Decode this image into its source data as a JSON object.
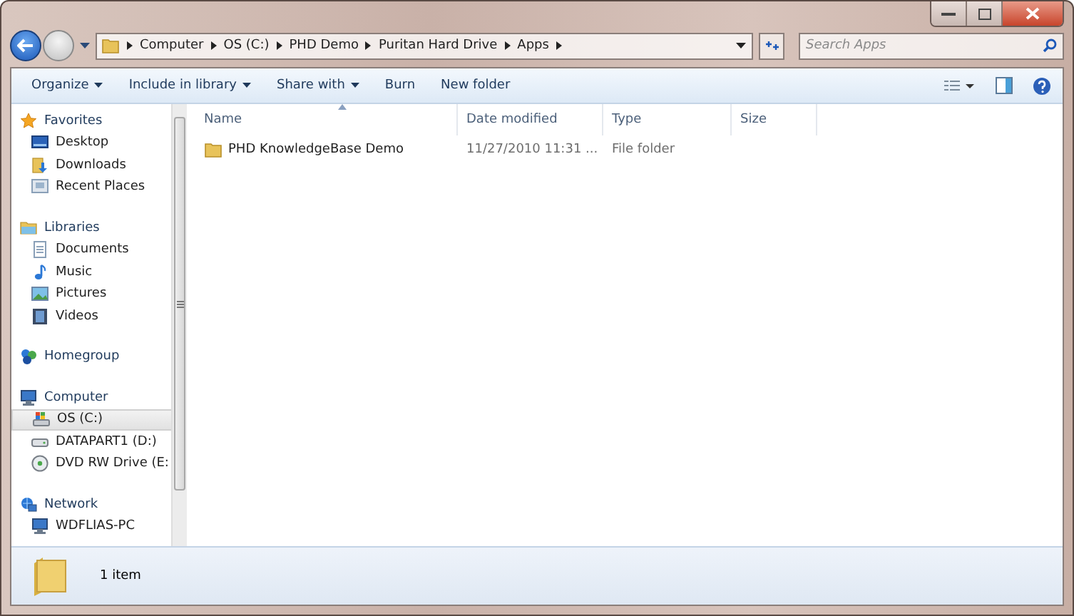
{
  "address_bar": {
    "breadcrumbs": [
      "Computer",
      "OS (C:)",
      "PHD Demo",
      "Puritan Hard Drive",
      "Apps"
    ]
  },
  "search": {
    "placeholder": "Search Apps"
  },
  "toolbar": {
    "buttons": [
      {
        "label": "Organize",
        "dropdown": true
      },
      {
        "label": "Include in library",
        "dropdown": true
      },
      {
        "label": "Share with",
        "dropdown": true
      },
      {
        "label": "Burn",
        "dropdown": false
      },
      {
        "label": "New folder",
        "dropdown": false
      }
    ]
  },
  "navigation": [
    {
      "label": "Favorites",
      "kind": "star",
      "children": [
        {
          "label": "Desktop",
          "kind": "desktop",
          "selected": false
        },
        {
          "label": "Downloads",
          "kind": "downloads",
          "selected": false
        },
        {
          "label": "Recent Places",
          "kind": "recent",
          "selected": false
        }
      ]
    },
    {
      "label": "Libraries",
      "kind": "library",
      "children": [
        {
          "label": "Documents",
          "kind": "documents",
          "selected": false
        },
        {
          "label": "Music",
          "kind": "music",
          "selected": false
        },
        {
          "label": "Pictures",
          "kind": "pictures",
          "selected": false
        },
        {
          "label": "Videos",
          "kind": "videos",
          "selected": false
        }
      ]
    },
    {
      "label": "Homegroup",
      "kind": "homegroup"
    },
    {
      "label": "Computer",
      "kind": "computer",
      "children": [
        {
          "label": "OS (C:)",
          "kind": "osdrive",
          "selected": true
        },
        {
          "label": "DATAPART1 (D:)",
          "kind": "drive",
          "selected": false
        },
        {
          "label": "DVD RW Drive (E:",
          "kind": "dvd",
          "selected": false
        }
      ]
    },
    {
      "label": "Network",
      "kind": "network",
      "children": [
        {
          "label": "WDFLIAS-PC",
          "kind": "computer",
          "selected": false
        }
      ]
    }
  ],
  "table": {
    "columns": [
      "Name",
      "Date modified",
      "Type",
      "Size"
    ],
    "rows": [
      {
        "name": "PHD KnowledgeBase Demo",
        "date_modified": "11/27/2010 11:31 ...",
        "type": "File folder"
      }
    ]
  },
  "status_bar": {
    "text": "1 item"
  }
}
